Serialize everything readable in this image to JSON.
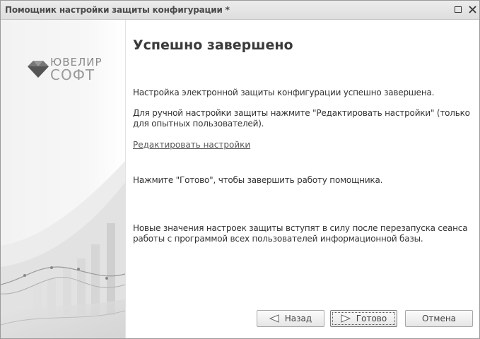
{
  "window": {
    "title": "Помощник настройки защиты конфигурации *"
  },
  "logo": {
    "line1": "ЮВЕЛИР",
    "line2": "СОФТ"
  },
  "content": {
    "heading": "Успешно завершено",
    "paragraph1": "Настройка электронной защиты конфигурации успешно завершена.",
    "paragraph2": "Для ручной настройки защиты нажмите \"Редактировать настройки\" (только для опытных пользователей).",
    "edit_link": "Редактировать настройки",
    "paragraph3": "Нажмите \"Готово\", чтобы завершить работу помощника.",
    "paragraph4": "Новые значения настроек защиты вступят в силу после перезапуска сеанса работы с программой всех пользователей информационной базы."
  },
  "buttons": {
    "back": "Назад",
    "done": "Готово",
    "cancel": "Отмена"
  },
  "icons": {
    "back": "triangle-left-icon",
    "done": "triangle-right-icon",
    "maximize": "maximize-icon",
    "close": "close-icon"
  }
}
